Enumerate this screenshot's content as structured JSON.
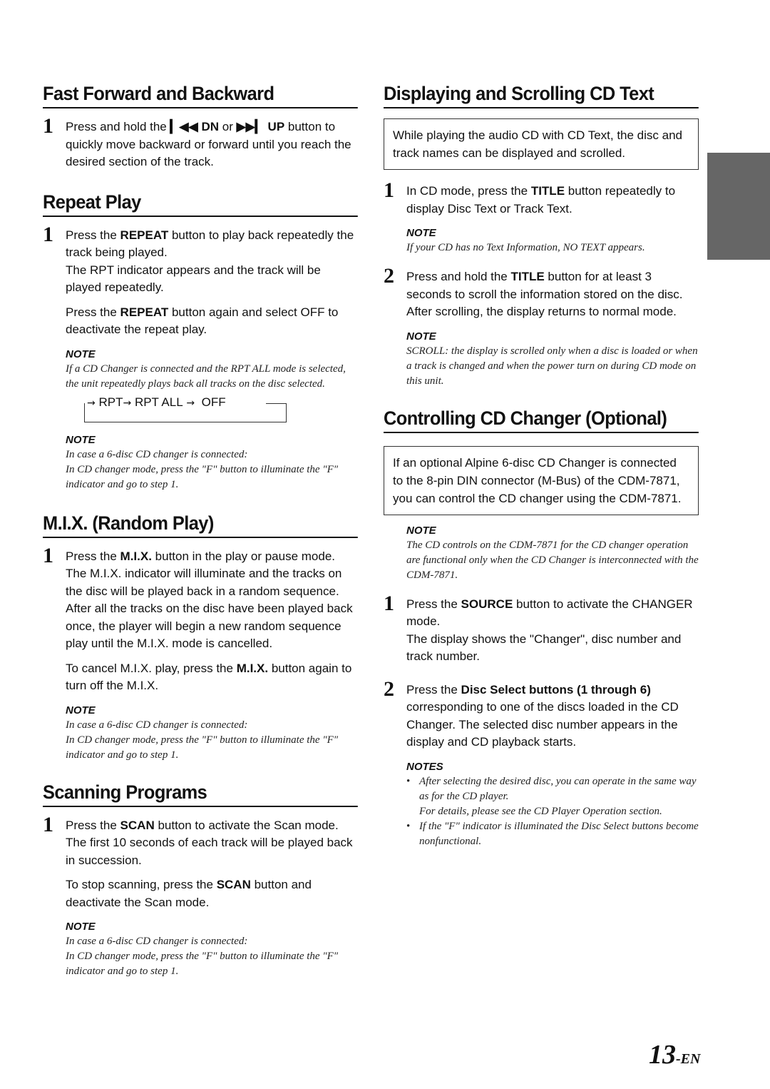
{
  "left_column": {
    "fast_forward": {
      "title": "Fast Forward and Backward",
      "step1": {
        "num": "1",
        "pre": "Press and hold the ",
        "btn_dn_icon": "skip-back-icon",
        "btn_dn": "DN",
        "mid": " or ",
        "btn_up_icon": "skip-forward-icon",
        "btn_up": "UP",
        "post": " button to quickly move backward or forward until you reach the desired section of the track."
      }
    },
    "repeat_play": {
      "title": "Repeat Play",
      "step1": {
        "num": "1",
        "pre": "Press the ",
        "bold": "REPEAT",
        "post": " button to play back repeatedly the track being played.",
        "line2": "The RPT indicator appears and the track will be played repeatedly."
      },
      "para": {
        "pre": "Press the ",
        "bold": "REPEAT",
        "post": " button again and select OFF to deactivate the repeat play."
      },
      "note1": {
        "heading": "NOTE",
        "text": "If a CD Changer is connected and the RPT ALL mode is selected, the unit repeatedly plays back all tracks on the disc selected."
      },
      "cycle": {
        "items": [
          "RPT",
          "RPT ALL",
          "OFF"
        ],
        "arrow": "→"
      },
      "note2": {
        "heading": "NOTE",
        "line1": "In case a 6-disc CD changer is connected:",
        "line2": "In CD changer mode, press the \"F\" button to illuminate the \"F\" indicator and go to step 1."
      }
    },
    "mix": {
      "title": "M.I.X. (Random Play)",
      "step1": {
        "num": "1",
        "pre": "Press the ",
        "bold": "M.I.X.",
        "post": " button in the play or pause mode.",
        "line2": "The M.I.X. indicator will illuminate and the tracks on the disc will be played back in a random sequence. After all the tracks on the disc have been played back once, the player will begin a new random sequence play until the M.I.X. mode is cancelled."
      },
      "para": {
        "pre": "To cancel M.I.X. play, press the ",
        "bold": "M.I.X.",
        "post": " button again to turn off the M.I.X."
      },
      "note": {
        "heading": "NOTE",
        "line1": "In case a 6-disc CD changer is connected:",
        "line2": "In CD changer mode, press the \"F\" button to illuminate the \"F\" indicator and go to step 1."
      }
    },
    "scanning": {
      "title": "Scanning Programs",
      "step1": {
        "num": "1",
        "pre": "Press the ",
        "bold": "SCAN",
        "post": " button to activate the Scan mode.",
        "line2": "The first 10 seconds of each track will be played back in succession."
      },
      "para": {
        "pre": "To stop scanning, press the ",
        "bold": "SCAN",
        "post": " button and deactivate the Scan mode."
      },
      "note": {
        "heading": "NOTE",
        "line1": "In case a 6-disc CD changer is connected:",
        "line2": "In CD changer mode, press the \"F\" button to illuminate the \"F\" indicator and go to step 1."
      }
    }
  },
  "right_column": {
    "cd_text": {
      "title": "Displaying and Scrolling CD Text",
      "intro_box": "While playing the audio CD with CD Text, the disc and track names can be displayed and scrolled.",
      "step1": {
        "num": "1",
        "pre": "In CD mode, press the ",
        "bold": "TITLE",
        "post": " button repeatedly to display Disc Text or Track Text."
      },
      "note1": {
        "heading": "NOTE",
        "text": "If your CD has no Text Information, NO TEXT appears."
      },
      "step2": {
        "num": "2",
        "pre": "Press and hold the ",
        "bold": "TITLE",
        "post": " button for at least 3 seconds to scroll the information stored on the disc.",
        "line2": "After scrolling, the display returns to normal mode."
      },
      "note2": {
        "heading": "NOTE",
        "text": "SCROLL: the display is scrolled only when a disc is loaded or when a track is changed and when the power turn on during CD mode on this unit."
      }
    },
    "cd_changer": {
      "title": "Controlling CD Changer (Optional)",
      "intro_box": "If an optional Alpine 6-disc CD Changer is connected to the 8-pin DIN connector (M-Bus) of the CDM-7871, you can control the CD changer using the CDM-7871.",
      "note": {
        "heading": "NOTE",
        "text": "The CD controls on the CDM-7871 for the CD changer operation are functional only when the CD Changer is interconnected with the CDM-7871."
      },
      "step1": {
        "num": "1",
        "pre": "Press the ",
        "bold": "SOURCE",
        "post": " button to activate the CHANGER mode.",
        "line2": "The display shows the \"Changer\", disc number and track number."
      },
      "step2": {
        "num": "2",
        "pre": "Press the ",
        "bold": "Disc Select buttons (1 through 6)",
        "post": " corresponding to one of the discs loaded in the CD Changer. The selected disc number appears in the display and CD playback starts."
      },
      "notes": {
        "heading": "NOTES",
        "bullets": [
          {
            "line1": "After selecting the desired disc, you can operate in the same way as for the CD player.",
            "line2": "For details, please see the CD Player Operation section."
          },
          {
            "line1": "If the \"F\" indicator is illuminated the Disc Select buttons become nonfunctional."
          }
        ]
      }
    }
  },
  "page": {
    "number": "13",
    "suffix": "-EN",
    "side_tab_color": "#666666"
  }
}
